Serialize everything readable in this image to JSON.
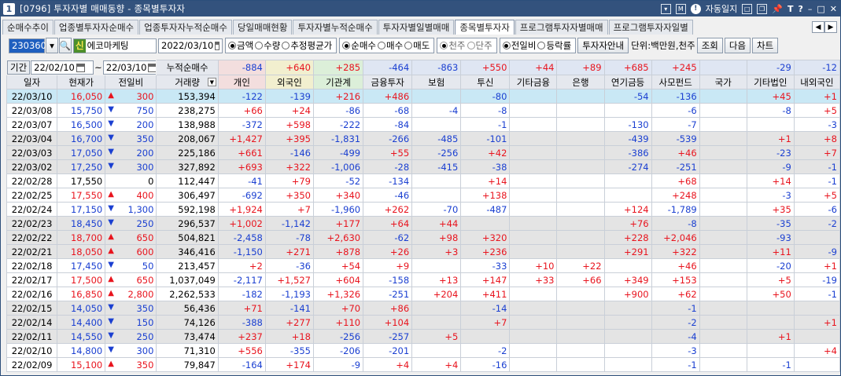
{
  "window": {
    "screen_no": "1",
    "title": "[0796] 투자자별 매매동향 - 종목별투자자",
    "autolock": "자동일지"
  },
  "tabs": [
    "순매수추이",
    "업종별투자자순매수",
    "업종투자자누적순매수",
    "당일매매현황",
    "투자자별누적순매수",
    "투자자별일별매매",
    "종목별투자자",
    "프로그램투자자별매매",
    "프로그램투자자일별"
  ],
  "active_tab": "종목별투자자",
  "controls": {
    "code": "230360",
    "stock_tag": "신",
    "stock_name": "에코마케팅",
    "date": "2022/03/10",
    "r1": [
      "금액",
      "수량",
      "추정평균가"
    ],
    "r2": [
      "순매수",
      "매수",
      "매도"
    ],
    "r3": [
      "천주",
      "단주"
    ],
    "r4": [
      "전일비",
      "등락률"
    ],
    "guide": "투자자안내",
    "unit": "단위:백만원,천주",
    "query": "조회",
    "next": "다음",
    "chart": "차트"
  },
  "period": {
    "label": "기간",
    "from": "22/02/10",
    "to": "22/03/10",
    "cum_label": "누적순매수"
  },
  "summary": [
    "-884",
    "+640",
    "+285",
    "-464",
    "-863",
    "+550",
    "+44",
    "+89",
    "+685",
    "+245",
    "",
    "-29",
    "-12"
  ],
  "columns": [
    "일자",
    "현재가",
    "전일비",
    "거래량",
    "개인",
    "외국인",
    "기관계",
    "금융투자",
    "보험",
    "투신",
    "기타금융",
    "은행",
    "연기금등",
    "사모펀드",
    "국가",
    "기타법인",
    "내외국인"
  ],
  "colors": {
    "up": "#e8141e",
    "down": "#1a3fd1",
    "title": "#33527d",
    "selected": "#c9e8f5"
  },
  "rows": [
    {
      "date": "22/03/10",
      "price": "16,050",
      "dir": "up",
      "chg": "300",
      "vol": "153,394",
      "v": [
        "-122",
        "-139",
        "+216",
        "+486",
        "",
        "-80",
        "",
        "",
        "-54",
        "-136",
        "",
        "+45",
        "+1"
      ],
      "style": "sel"
    },
    {
      "date": "22/03/08",
      "price": "15,750",
      "dir": "dn",
      "chg": "750",
      "vol": "238,275",
      "v": [
        "+66",
        "+24",
        "-86",
        "-68",
        "-4",
        "-8",
        "",
        "",
        "",
        "-6",
        "",
        "-8",
        "+5"
      ],
      "style": "wht"
    },
    {
      "date": "22/03/07",
      "price": "16,500",
      "dir": "dn",
      "chg": "200",
      "vol": "138,988",
      "v": [
        "-372",
        "+598",
        "-222",
        "-84",
        "",
        "-1",
        "",
        "",
        "-130",
        "-7",
        "",
        "",
        "-3"
      ],
      "style": "wht"
    },
    {
      "date": "22/03/04",
      "price": "16,700",
      "dir": "dn",
      "chg": "350",
      "vol": "208,067",
      "v": [
        "+1,427",
        "+395",
        "-1,831",
        "-266",
        "-485",
        "-101",
        "",
        "",
        "-439",
        "-539",
        "",
        "+1",
        "+8"
      ],
      "style": "gry"
    },
    {
      "date": "22/03/03",
      "price": "17,050",
      "dir": "dn",
      "chg": "200",
      "vol": "225,186",
      "v": [
        "+661",
        "-146",
        "-499",
        "+55",
        "-256",
        "+42",
        "",
        "",
        "-386",
        "+46",
        "",
        "-23",
        "+7"
      ],
      "style": "gry"
    },
    {
      "date": "22/03/02",
      "price": "17,250",
      "dir": "dn",
      "chg": "300",
      "vol": "327,892",
      "v": [
        "+693",
        "+322",
        "-1,006",
        "-28",
        "-415",
        "-38",
        "",
        "",
        "-274",
        "-251",
        "",
        "-9",
        "-1"
      ],
      "style": "gry"
    },
    {
      "date": "22/02/28",
      "price": "17,550",
      "dir": "",
      "chg": "0",
      "vol": "112,447",
      "v": [
        "-41",
        "+79",
        "-52",
        "-134",
        "",
        "+14",
        "",
        "",
        "",
        "+68",
        "",
        "+14",
        "-1"
      ],
      "style": "wht"
    },
    {
      "date": "22/02/25",
      "price": "17,550",
      "dir": "up",
      "chg": "400",
      "vol": "306,497",
      "v": [
        "-692",
        "+350",
        "+340",
        "-46",
        "",
        "+138",
        "",
        "",
        "",
        "+248",
        "",
        "-3",
        "+5"
      ],
      "style": "wht"
    },
    {
      "date": "22/02/24",
      "price": "17,150",
      "dir": "dn",
      "chg": "1,300",
      "vol": "592,198",
      "v": [
        "+1,924",
        "+7",
        "-1,960",
        "+262",
        "-70",
        "-487",
        "",
        "",
        "+124",
        "-1,789",
        "",
        "+35",
        "-6"
      ],
      "style": "wht"
    },
    {
      "date": "22/02/23",
      "price": "18,450",
      "dir": "dn",
      "chg": "250",
      "vol": "296,537",
      "v": [
        "+1,002",
        "-1,142",
        "+177",
        "+64",
        "+44",
        "",
        "",
        "",
        "+76",
        "-8",
        "",
        "-35",
        "-2"
      ],
      "style": "gry"
    },
    {
      "date": "22/02/22",
      "price": "18,700",
      "dir": "up",
      "chg": "650",
      "vol": "504,821",
      "v": [
        "-2,458",
        "-78",
        "+2,630",
        "-62",
        "+98",
        "+320",
        "",
        "",
        "+228",
        "+2,046",
        "",
        "-93",
        ""
      ],
      "style": "gry"
    },
    {
      "date": "22/02/21",
      "price": "18,050",
      "dir": "up",
      "chg": "600",
      "vol": "346,416",
      "v": [
        "-1,150",
        "+271",
        "+878",
        "+26",
        "+3",
        "+236",
        "",
        "",
        "+291",
        "+322",
        "",
        "+11",
        "-9"
      ],
      "style": "gry"
    },
    {
      "date": "22/02/18",
      "price": "17,450",
      "dir": "dn",
      "chg": "50",
      "vol": "213,457",
      "v": [
        "+2",
        "-36",
        "+54",
        "+9",
        "",
        "-33",
        "+10",
        "+22",
        "",
        "+46",
        "",
        "-20",
        "+1"
      ],
      "style": "wht"
    },
    {
      "date": "22/02/17",
      "price": "17,500",
      "dir": "up",
      "chg": "650",
      "vol": "1,037,049",
      "v": [
        "-2,117",
        "+1,527",
        "+604",
        "-158",
        "+13",
        "+147",
        "+33",
        "+66",
        "+349",
        "+153",
        "",
        "+5",
        "-19"
      ],
      "style": "wht"
    },
    {
      "date": "22/02/16",
      "price": "16,850",
      "dir": "up",
      "chg": "2,800",
      "vol": "2,262,533",
      "v": [
        "-182",
        "-1,193",
        "+1,326",
        "-251",
        "+204",
        "+411",
        "",
        "",
        "+900",
        "+62",
        "",
        "+50",
        "-1"
      ],
      "style": "wht"
    },
    {
      "date": "22/02/15",
      "price": "14,050",
      "dir": "dn",
      "chg": "350",
      "vol": "56,436",
      "v": [
        "+71",
        "-141",
        "+70",
        "+86",
        "",
        "-14",
        "",
        "",
        "",
        "-1",
        "",
        "",
        ""
      ],
      "style": "gry"
    },
    {
      "date": "22/02/14",
      "price": "14,400",
      "dir": "dn",
      "chg": "150",
      "vol": "74,126",
      "v": [
        "-388",
        "+277",
        "+110",
        "+104",
        "",
        "+7",
        "",
        "",
        "",
        "-2",
        "",
        "",
        "+1"
      ],
      "style": "gry"
    },
    {
      "date": "22/02/11",
      "price": "14,550",
      "dir": "dn",
      "chg": "250",
      "vol": "73,474",
      "v": [
        "+237",
        "+18",
        "-256",
        "-257",
        "+5",
        "",
        "",
        "",
        "",
        "-4",
        "",
        "+1",
        ""
      ],
      "style": "gry"
    },
    {
      "date": "22/02/10",
      "price": "14,800",
      "dir": "dn",
      "chg": "300",
      "vol": "71,310",
      "v": [
        "+556",
        "-355",
        "-206",
        "-201",
        "",
        "-2",
        "",
        "",
        "",
        "-3",
        "",
        "",
        "+4"
      ],
      "style": "wht"
    },
    {
      "date": "22/02/09",
      "price": "15,100",
      "dir": "up",
      "chg": "350",
      "vol": "79,847",
      "v": [
        "-164",
        "+174",
        "-9",
        "+4",
        "+4",
        "-16",
        "",
        "",
        "",
        "-1",
        "",
        "-1",
        ""
      ],
      "style": "wht"
    }
  ]
}
